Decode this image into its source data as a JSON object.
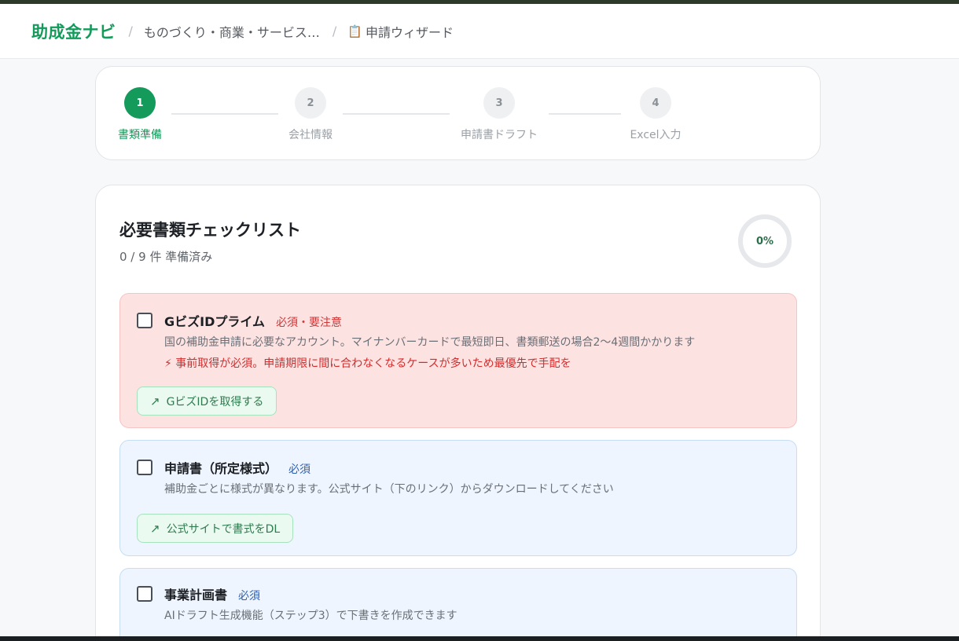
{
  "header": {
    "brand": "助成金ナビ",
    "separator": "/",
    "crumb_program": "ものづくり・商業・サービス…",
    "crumb_wizard_icon": "clipboard-icon",
    "crumb_wizard": "申請ウィザード"
  },
  "stepper": {
    "steps": [
      {
        "number": "1",
        "label": "書類準備",
        "active": true
      },
      {
        "number": "2",
        "label": "会社情報",
        "active": false
      },
      {
        "number": "3",
        "label": "申請書ドラフト",
        "active": false
      },
      {
        "number": "4",
        "label": "Excel入力",
        "active": false
      }
    ]
  },
  "checklist": {
    "title": "必要書類チェックリスト",
    "subtitle": "0 / 9 件 準備済み",
    "progress_percent_text": "0%",
    "progress_fraction": 0,
    "items": [
      {
        "title": "GビズIDプライム",
        "badge": "必須・要注意",
        "description": "国の補助金申請に必要なアカウント。マイナンバーカードで最短即日、書類郵送の場合2〜4週間かかります",
        "warning": "⚡ 事前取得が必須。申請期限に間に合わなくなるケースが多いため最優先で手配を",
        "link_icon": "arrow-up-right-icon",
        "link_label": "GビズIDを取得する",
        "checked": false
      },
      {
        "title": "申請書（所定様式）",
        "badge": "必須",
        "description": "補助金ごとに様式が異なります。公式サイト（下のリンク）からダウンロードしてください",
        "link_icon": "arrow-up-right-icon",
        "link_label": "公式サイトで書式をDL",
        "checked": false
      },
      {
        "title": "事業計画書",
        "badge": "必須",
        "description": "AIドラフト生成機能（ステップ3）で下書きを作成できます",
        "checked": false
      }
    ]
  },
  "colors": {
    "brand": "#149a5a",
    "critical_bg": "#fde2e2",
    "normal_bg": "#eef5fe",
    "critical_text": "#d03535",
    "badge_blue": "#2c5fb3"
  }
}
